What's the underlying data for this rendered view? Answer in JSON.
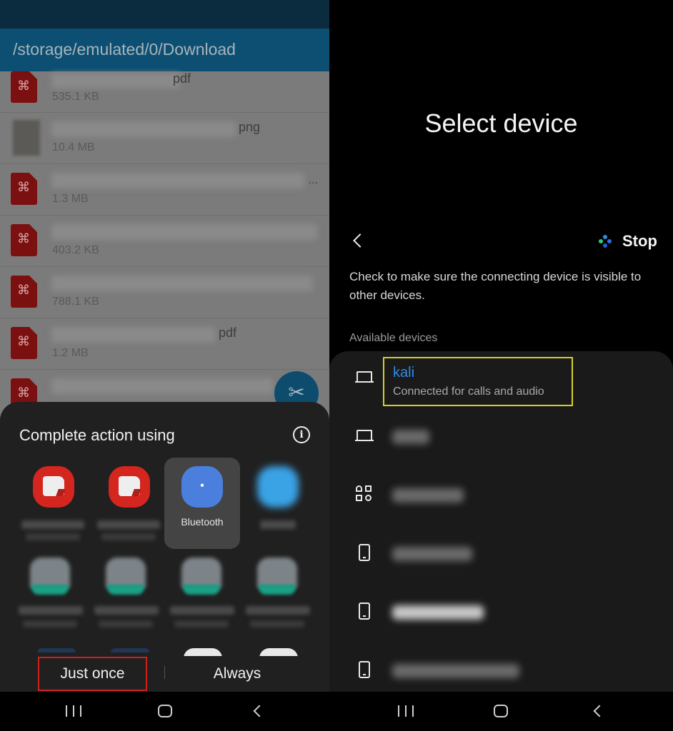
{
  "left": {
    "path": "/storage/emulated/0/Download",
    "files": [
      {
        "ext": "pdf",
        "size": "535.1 KB",
        "type": "pdf",
        "truncated": false
      },
      {
        "ext": "png",
        "size": "10.4 MB",
        "type": "image",
        "truncated": false
      },
      {
        "ext": "",
        "size": "1.3 MB",
        "type": "pdf",
        "truncated": true
      },
      {
        "ext": "",
        "size": "403.2 KB",
        "type": "pdf",
        "truncated": true
      },
      {
        "ext": "",
        "size": "788.1 KB",
        "type": "pdf",
        "truncated": true
      },
      {
        "ext": "pdf",
        "size": "1.2 MB",
        "type": "pdf",
        "truncated": false
      },
      {
        "ext": "",
        "size": "",
        "type": "pdf",
        "truncated": true
      }
    ],
    "ellipsis": "...",
    "fab_icon": "scissors-icon",
    "sheet": {
      "title": "Complete action using",
      "info_icon": "i",
      "apps": [
        {
          "label": "",
          "icon": "samsung-notes-icon",
          "blurred_label": true
        },
        {
          "label": "",
          "icon": "samsung-notes-icon",
          "blurred_label": true
        },
        {
          "label": "Bluetooth",
          "icon": "bluetooth-icon",
          "selected": true
        },
        {
          "label": "",
          "icon": "blurred-app-icon",
          "blurred_label": true
        }
      ],
      "camscanner_count": 4,
      "just_once": "Just once",
      "always": "Always"
    }
  },
  "right": {
    "title": "Select device",
    "stop": "Stop",
    "hint": "Check to make sure the connecting device is visible to other devices.",
    "available_label": "Available devices",
    "devices": [
      {
        "name": "kali",
        "status": "Connected for calls and audio",
        "icon": "laptop",
        "blurred": false,
        "highlighted": true
      },
      {
        "name": "",
        "icon": "laptop",
        "blurred": true
      },
      {
        "name": "",
        "icon": "accessory-grid",
        "blurred": true
      },
      {
        "name": "",
        "icon": "phone",
        "blurred": true
      },
      {
        "name": "",
        "icon": "phone",
        "blurred": true
      },
      {
        "name": "",
        "icon": "phone",
        "blurred": true
      }
    ],
    "colors": {
      "connected_name": "#2f8be6",
      "highlight_box": "#d6cf2a",
      "scan_dots": [
        "#2ecc71",
        "#2f6fe6",
        "#2f8be6",
        "#1f5fd6"
      ]
    }
  },
  "navbar": {
    "recents": "recents",
    "home": "home",
    "back": "back"
  }
}
